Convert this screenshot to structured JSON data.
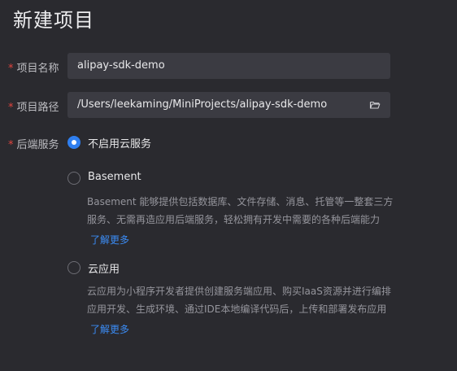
{
  "page": {
    "title": "新建项目"
  },
  "form": {
    "required_mark": "*",
    "name": {
      "label": "项目名称",
      "value": "alipay-sdk-demo"
    },
    "path": {
      "label": "项目路径",
      "value": "/Users/leekaming/MiniProjects/alipay-sdk-demo",
      "icon": "folder-open-icon"
    },
    "backend": {
      "label": "后端服务",
      "options": [
        {
          "label": "不启用云服务",
          "checked": true
        },
        {
          "label": "Basement",
          "checked": false,
          "description_lines": [
            "Basement 能够提供包括数据库、文件存储、消息、托管等一整套三方",
            "服务、无需再造应用后端服务，轻松拥有开发中需要的各种后端能力"
          ],
          "link": "了解更多"
        },
        {
          "label": "云应用",
          "checked": false,
          "description_lines": [
            "云应用为小程序开发者提供创建服务端应用、购买IaaS资源并进行编排",
            "应用开发、生成环境、通过IDE本地编译代码后，上传和部署发布应用"
          ],
          "link": "了解更多"
        }
      ]
    }
  },
  "colors": {
    "background": "#2a2a2f",
    "field_background": "#3b3b42",
    "accent": "#2f7ff0",
    "link": "#3b8cf5",
    "required": "#e0443e"
  }
}
